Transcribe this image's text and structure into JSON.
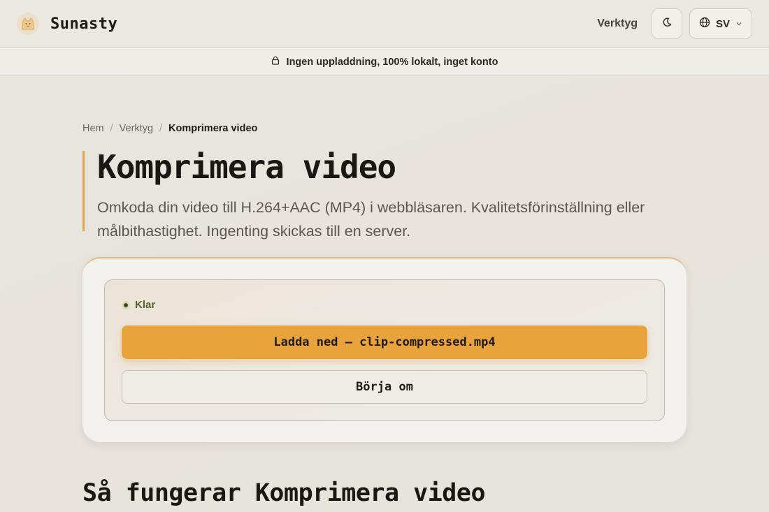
{
  "header": {
    "brand": "Sunasty",
    "nav_tools": "Verktyg",
    "language": "SV"
  },
  "banner": {
    "text": "Ingen uppladdning, 100% lokalt, inget konto"
  },
  "breadcrumb": {
    "items": [
      "Hem",
      "Verktyg",
      "Komprimera video"
    ]
  },
  "hero": {
    "title": "Komprimera video",
    "subtitle": "Omkoda din video till H.264+AAC (MP4) i webbläsaren. Kvalitetsförinställning eller målbithastighet. Ingenting skickas till en server."
  },
  "result": {
    "status": "Klar",
    "download_label": "Ladda ned — clip-compressed.mp4",
    "restart_label": "Börja om"
  },
  "section": {
    "how_title": "Så fungerar Komprimera video"
  },
  "colors": {
    "accent": "#e9a33d",
    "status": "#55612b"
  },
  "icons": {
    "logo": "cat-logo-icon",
    "theme": "moon-icon",
    "language": "globe-icon",
    "dropdown": "chevron-down-icon",
    "banner": "lock-icon",
    "status": "status-dot-icon"
  }
}
